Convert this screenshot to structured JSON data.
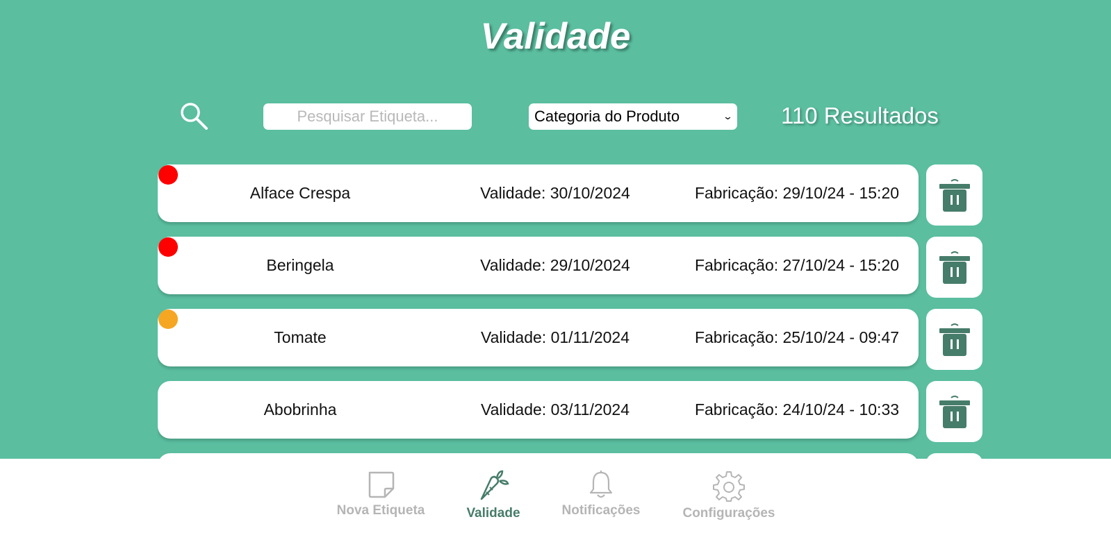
{
  "header": {
    "title": "Validade"
  },
  "toolbar": {
    "search_placeholder": "Pesquisar Etiqueta...",
    "category_label": "Categoria do Produto",
    "results_text": "110 Resultados"
  },
  "items": [
    {
      "name": "Alface Crespa",
      "validade": "Validade: 30/10/2024",
      "fabricacao": "Fabricação: 29/10/24 - 15:20",
      "status_color": "#ff0000"
    },
    {
      "name": "Beringela",
      "validade": "Validade: 29/10/2024",
      "fabricacao": "Fabricação: 27/10/24 - 15:20",
      "status_color": "#ff0000"
    },
    {
      "name": "Tomate",
      "validade": "Validade: 01/11/2024",
      "fabricacao": "Fabricação: 25/10/24 - 09:47",
      "status_color": "#f5a623"
    },
    {
      "name": "Abobrinha",
      "validade": "Validade: 03/11/2024",
      "fabricacao": "Fabricação: 24/10/24 - 10:33",
      "status_color": null
    }
  ],
  "nav": {
    "items": [
      {
        "label": "Nova Etiqueta",
        "icon": "sticky-note-icon",
        "active": false
      },
      {
        "label": "Validade",
        "icon": "carrot-icon",
        "active": true
      },
      {
        "label": "Notificações",
        "icon": "bell-icon",
        "active": false
      },
      {
        "label": "Configurações",
        "icon": "gear-icon",
        "active": false
      }
    ]
  },
  "colors": {
    "background": "#5abe9f",
    "accent_dark": "#467c6a",
    "inactive": "#b5b5b5",
    "urgent": "#ff0000",
    "warning": "#f5a623"
  }
}
